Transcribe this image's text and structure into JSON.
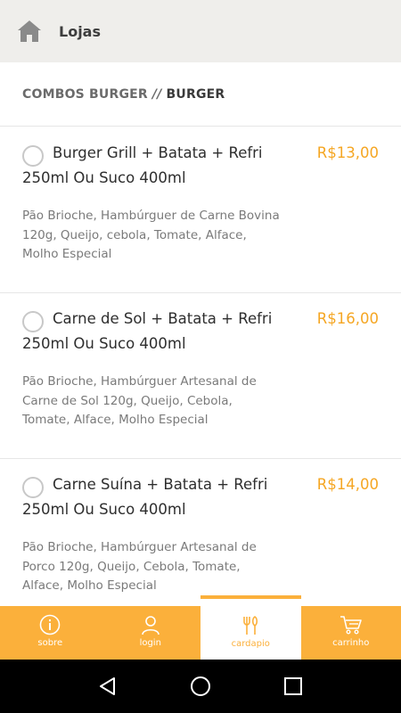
{
  "header": {
    "title": "Lojas",
    "home_icon": "home-icon"
  },
  "breadcrumb": {
    "parent": "COMBOS BURGER",
    "separator": "//",
    "current": "BURGER"
  },
  "colors": {
    "accent": "#fbb03b",
    "price": "#f5a623",
    "header_bg": "#efeeeb"
  },
  "items": [
    {
      "title": "Burger Grill + Batata + Refri 250ml Ou Suco 400ml",
      "price": "R$13,00",
      "description": "Pão Brioche, Hambúrguer de Carne Bovina 120g, Queijo, cebola, Tomate, Alface, Molho Especial",
      "selected": false
    },
    {
      "title": "Carne de Sol + Batata + Refri 250ml Ou Suco 400ml",
      "price": "R$16,00",
      "description": "Pão Brioche, Hambúrguer Artesanal de Carne de Sol 120g, Queijo, Cebola, Tomate, Alface, Molho Especial",
      "selected": false
    },
    {
      "title": "Carne Suína + Batata + Refri 250ml Ou Suco 400ml",
      "price": "R$14,00",
      "description": "Pão Brioche, Hambúrguer Artesanal de Porco 120g, Queijo, Cebola, Tomate, Alface, Molho Especial",
      "selected": false
    }
  ],
  "bottom_nav": [
    {
      "label": "sobre",
      "icon": "info-icon",
      "active": false
    },
    {
      "label": "login",
      "icon": "user-icon",
      "active": false
    },
    {
      "label": "cardapio",
      "icon": "cutlery-icon",
      "active": true
    },
    {
      "label": "carrinho",
      "icon": "cart-icon",
      "active": false
    }
  ],
  "system_nav": {
    "back": "back-icon",
    "home": "home-circle-icon",
    "recents": "recents-icon"
  }
}
